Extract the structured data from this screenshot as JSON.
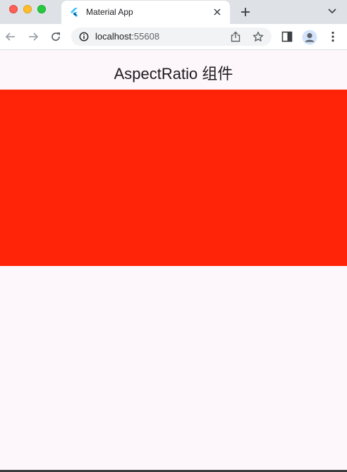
{
  "browser": {
    "tab": {
      "title": "Material App",
      "favicon": "flutter-icon"
    },
    "address_bar": {
      "host": "localhost",
      "port": ":55608"
    },
    "icons": {
      "back": "arrow-left-icon",
      "forward": "arrow-right-icon",
      "reload": "reload-icon",
      "info": "info-icon",
      "share": "share-icon",
      "bookmark": "star-icon",
      "side_panel": "side-panel-icon",
      "profile": "profile-icon",
      "menu": "kebab-menu-icon",
      "new_tab": "plus-icon",
      "tab_search": "chevron-down-icon",
      "close_tab": "close-icon"
    }
  },
  "app": {
    "appbar_title": "AspectRatio 组件",
    "aspect_box": {
      "color": "#ff2407",
      "aspect_ratio": 2.0
    },
    "background_color": "#fdf7fc"
  }
}
